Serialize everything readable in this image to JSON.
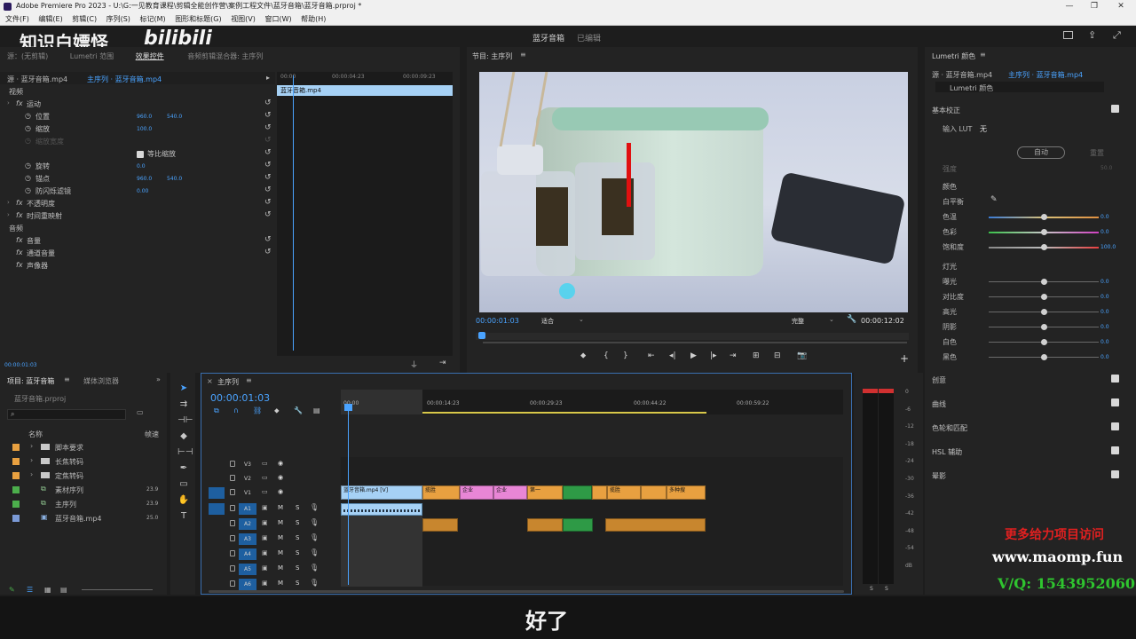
{
  "titlebar": {
    "title": "Adobe Premiere Pro 2023 - U:\\G:一见教育课程\\剪辑全能创作营\\案例工程文件\\蓝牙音箱\\蓝牙音箱.prproj *"
  },
  "menu": [
    "文件(F)",
    "编辑(E)",
    "剪辑(C)",
    "序列(S)",
    "标记(M)",
    "图形和标题(G)",
    "视图(V)",
    "窗口(W)",
    "帮助(H)"
  ],
  "header": {
    "project_title": "蓝牙音箱",
    "status": "已编辑",
    "watermark_left": "知识白嫖怪",
    "watermark_brand": "bilibili"
  },
  "effects": {
    "tabs": [
      "源：(无剪辑)",
      "Lumetri 范围",
      "效果控件",
      "音频剪辑混合器: 主序列"
    ],
    "source_label": "源 · 蓝牙音箱.mp4",
    "sequence_label": "主序列 · 蓝牙音箱.mp4",
    "ruler": [
      "00:00",
      "00:00:04:23",
      "00:00:09:23"
    ],
    "clip_label": "蓝牙音箱.mp4",
    "video_header": "视频",
    "audio_header": "音频",
    "rows": [
      {
        "label": "运动",
        "fx": true
      },
      {
        "label": "位置",
        "v1": "960.0",
        "v2": "540.0"
      },
      {
        "label": "缩放",
        "v1": "100.0"
      },
      {
        "label": "缩放宽度",
        "dim": true
      },
      {
        "label": "等比缩放",
        "checkbox": true
      },
      {
        "label": "旋转",
        "v1": "0.0"
      },
      {
        "label": "锚点",
        "v1": "960.0",
        "v2": "540.0"
      },
      {
        "label": "防闪烁滤镜",
        "v1": "0.00"
      },
      {
        "label": "不透明度",
        "fx": true
      },
      {
        "label": "时间重映射",
        "fx": true
      }
    ],
    "audio_rows": [
      "音量",
      "通道音量",
      "声像器"
    ],
    "timecode": "00:00:01:03"
  },
  "program": {
    "title": "节目: 主序列",
    "timecode": "00:00:01:03",
    "fit": "适合",
    "quality": "完整",
    "duration": "00:00:12:02"
  },
  "lumetri": {
    "title": "Lumetri 颜色",
    "source": "源 · 蓝牙音箱.mp4",
    "target": "主序列 · 蓝牙音箱.mp4",
    "preset": "Lumetri 颜色",
    "basic": "基本校正",
    "lut_label": "输入 LUT",
    "lut_value": "无",
    "auto": "自动",
    "reset": "重置",
    "intensity_label": "强度",
    "intensity_value": "50.0",
    "color_section": "颜色",
    "white_balance": "白平衡",
    "color_rows": [
      {
        "label": "色温",
        "value": "0.0",
        "pos": 0.5
      },
      {
        "label": "色彩",
        "value": "0.0",
        "pos": 0.5
      },
      {
        "label": "饱和度",
        "value": "100.0",
        "pos": 0.5
      }
    ],
    "light_section": "灯光",
    "light_rows": [
      {
        "label": "曝光",
        "value": "0.0"
      },
      {
        "label": "对比度",
        "value": "0.0"
      },
      {
        "label": "高光",
        "value": "0.0"
      },
      {
        "label": "阴影",
        "value": "0.0"
      },
      {
        "label": "白色",
        "value": "0.0"
      },
      {
        "label": "黑色",
        "value": "0.0"
      }
    ],
    "sections": [
      "创意",
      "曲线",
      "色轮和匹配",
      "HSL 辅助",
      "晕影"
    ]
  },
  "project": {
    "tabs": [
      "项目: 蓝牙音箱",
      "媒体浏览器"
    ],
    "file": "蓝牙音箱.prproj",
    "col_name": "名称",
    "col_rate": "帧速",
    "items": [
      {
        "name": "脚本要求",
        "color": "#e8a040",
        "type": "folder",
        "rate": ""
      },
      {
        "name": "长焦转码",
        "color": "#e8a040",
        "type": "folder",
        "rate": ""
      },
      {
        "name": "定焦转码",
        "color": "#e8a040",
        "type": "folder",
        "rate": ""
      },
      {
        "name": "素材序列",
        "color": "#4cae4c",
        "type": "seq",
        "rate": "23.9"
      },
      {
        "name": "主序列",
        "color": "#4cae4c",
        "type": "seq",
        "rate": "23.9"
      },
      {
        "name": "蓝牙音箱.mp4",
        "color": "#7b9ad6",
        "type": "clip",
        "rate": "25.0"
      }
    ]
  },
  "timeline": {
    "tab": "主序列",
    "timecode": "00:00:01:03",
    "ruler": [
      "00:00",
      "00:00:14:23",
      "00:00:29:23",
      "00:00:44:22",
      "00:00:59:22"
    ],
    "tracks": [
      "V3",
      "V2",
      "V1",
      "A1",
      "A2",
      "A3",
      "A4",
      "A5",
      "A6"
    ],
    "v1_clips": [
      {
        "label": "蓝牙音箱.mp4 [V]",
        "color": "#a6d1f5"
      },
      {
        "label": "揽胜",
        "color": "#e8a040"
      },
      {
        "label": "企业",
        "color": "#e886d6"
      },
      {
        "label": "企业",
        "color": "#e886d6"
      },
      {
        "label": "第一",
        "color": "#e8a040"
      },
      {
        "label": "",
        "color": "#2e9a46"
      },
      {
        "label": "",
        "color": "#e8a040"
      },
      {
        "label": "揽胜",
        "color": "#e8a040"
      },
      {
        "label": "",
        "color": "#e8a040"
      },
      {
        "label": "多种搜",
        "color": "#e8a040"
      }
    ]
  },
  "meter": {
    "ticks": [
      "0",
      "-6",
      "-12",
      "-18",
      "-24",
      "-30",
      "-36",
      "-42",
      "-48",
      "-54",
      "dB"
    ],
    "solo": [
      "S",
      "S"
    ]
  },
  "overlay": {
    "ad1": "更多给力项目访问",
    "ad2": "www.maomp.fun",
    "ad3": "V/Q: 1543952060",
    "subtitle": "好了"
  }
}
